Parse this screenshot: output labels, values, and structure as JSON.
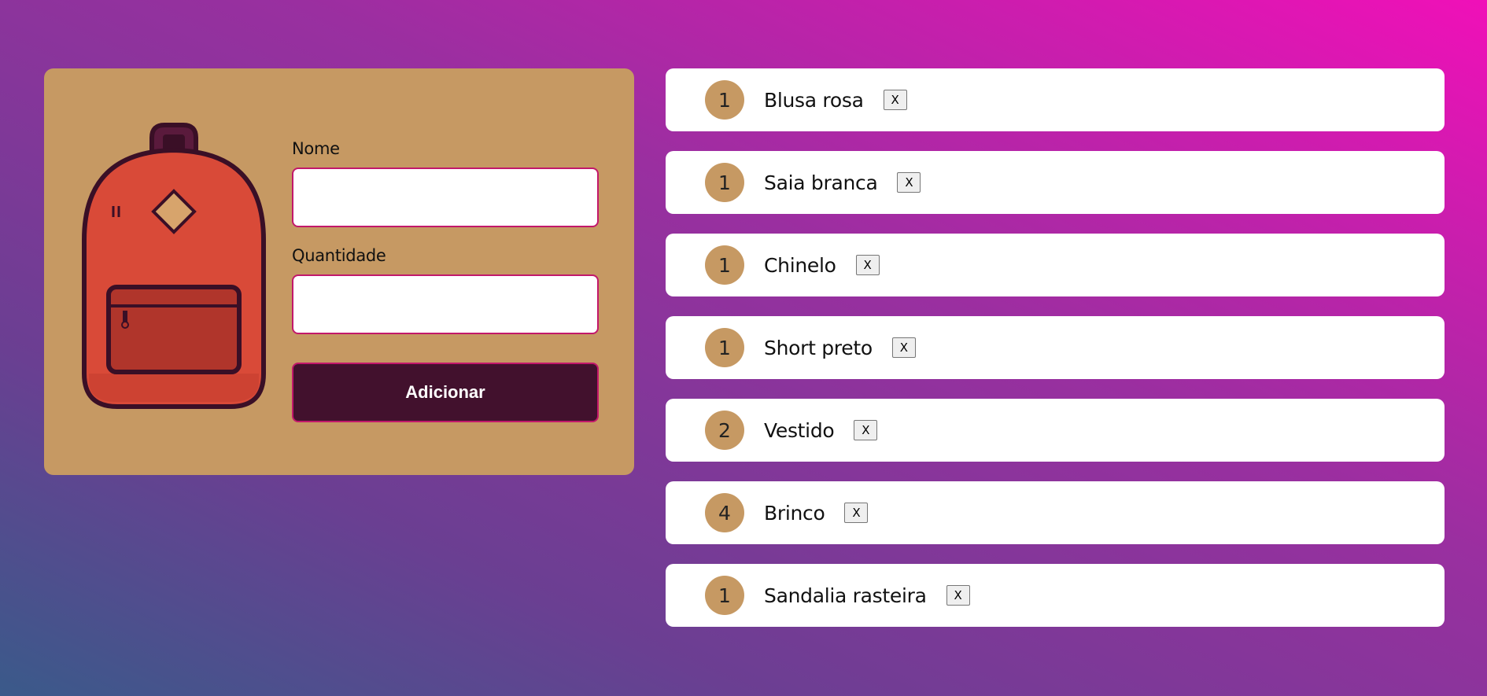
{
  "form": {
    "name_label": "Nome",
    "name_value": "",
    "quantity_label": "Quantidade",
    "quantity_value": "",
    "submit_label": "Adicionar"
  },
  "icons": {
    "illustration": "backpack-icon"
  },
  "colors": {
    "panel": "#c69963",
    "button": "#42112d",
    "input_border": "#c2186b",
    "backpack": "#d94a38"
  },
  "items": [
    {
      "quantity": "1",
      "name": "Blusa rosa",
      "delete_label": "X"
    },
    {
      "quantity": "1",
      "name": "Saia branca",
      "delete_label": "X"
    },
    {
      "quantity": "1",
      "name": "Chinelo",
      "delete_label": "X"
    },
    {
      "quantity": "1",
      "name": "Short preto",
      "delete_label": "X"
    },
    {
      "quantity": "2",
      "name": "Vestido",
      "delete_label": "X"
    },
    {
      "quantity": "4",
      "name": "Brinco",
      "delete_label": "X"
    },
    {
      "quantity": "1",
      "name": "Sandalia rasteira",
      "delete_label": "X"
    }
  ]
}
